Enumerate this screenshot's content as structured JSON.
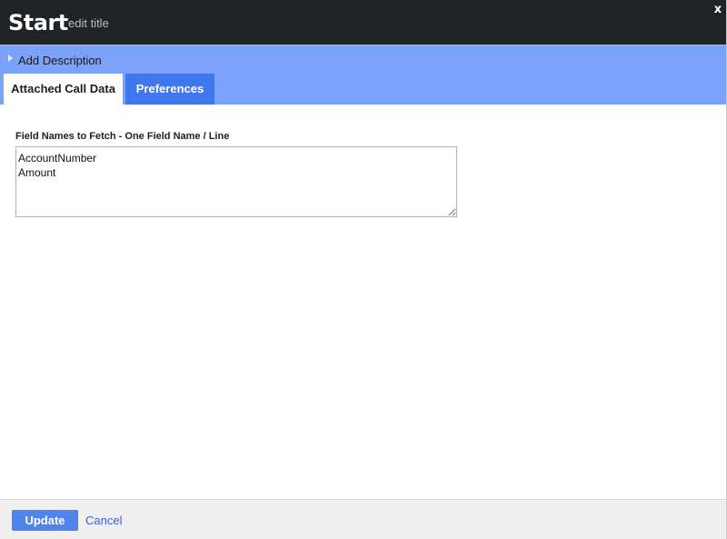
{
  "dialog": {
    "title": "Start",
    "edit_title_label": "edit title",
    "close_glyph": "x"
  },
  "description": {
    "label": "Add Description",
    "caret_icon": "caret-right-icon"
  },
  "tabs": [
    {
      "label": "Attached Call Data",
      "active": true
    },
    {
      "label": "Preferences",
      "active": false
    }
  ],
  "form": {
    "field_label": "Field Names to Fetch - One Field Name / Line",
    "field_value": "AccountNumber\nAmount"
  },
  "footer": {
    "update_label": "Update",
    "cancel_label": "Cancel"
  },
  "colors": {
    "title_bar": "#212426",
    "band_blue": "#7aa2fb",
    "tab_inactive": "#3f78ee",
    "button_blue": "#4e84ec",
    "link_blue": "#3562df",
    "footer_bg": "#efefef"
  }
}
